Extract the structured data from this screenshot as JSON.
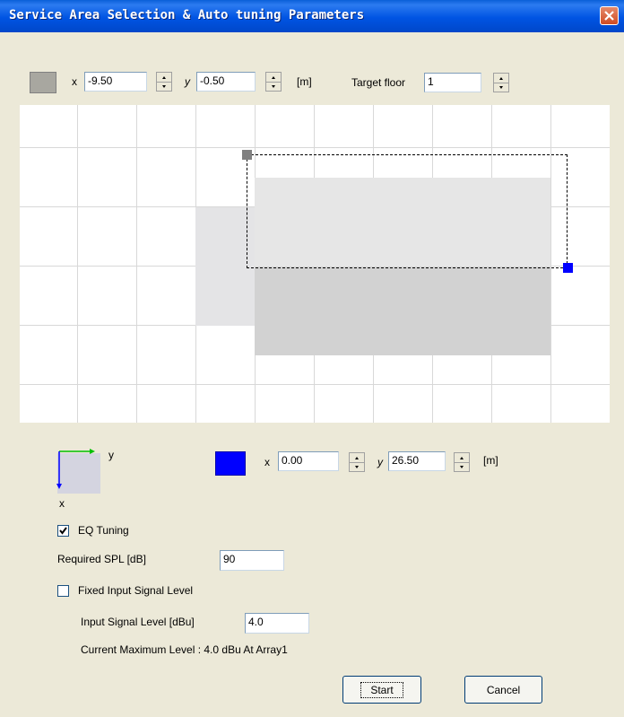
{
  "window": {
    "title": "Service Area Selection & Auto tuning Parameters",
    "close_glyph": "✕"
  },
  "colors": {
    "titlebar": "#0054e3",
    "anchor_top_left": "#a8a7a0",
    "anchor_bottom_right": "#0000ff",
    "area_light": "#e6e6e6",
    "area_dark": "#d2d2d2",
    "room_left": "#e4e4e6"
  },
  "top_point": {
    "x_label": "x",
    "x_value": "-9.50",
    "y_label": "y",
    "y_value": "-0.50",
    "unit": "[m]"
  },
  "target_floor": {
    "label": "Target floor",
    "value": "1"
  },
  "bottom_point": {
    "x_label": "x",
    "x_value": "0.00",
    "y_label": "y",
    "y_value": "26.50",
    "unit": "[m]"
  },
  "axes": {
    "x_label": "x",
    "y_label": "y"
  },
  "eq_tuning": {
    "label": "EQ Tuning",
    "checked": true
  },
  "required_spl": {
    "label": "Required SPL [dB]",
    "value": "90"
  },
  "fixed_input": {
    "label": "Fixed Input Signal Level",
    "checked": false
  },
  "input_level": {
    "label": "Input Signal Level [dBu]",
    "value": "4.0"
  },
  "current_max": "Current Maximum Level : 4.0 dBu At Array1",
  "buttons": {
    "start": "Start",
    "cancel": "Cancel"
  }
}
